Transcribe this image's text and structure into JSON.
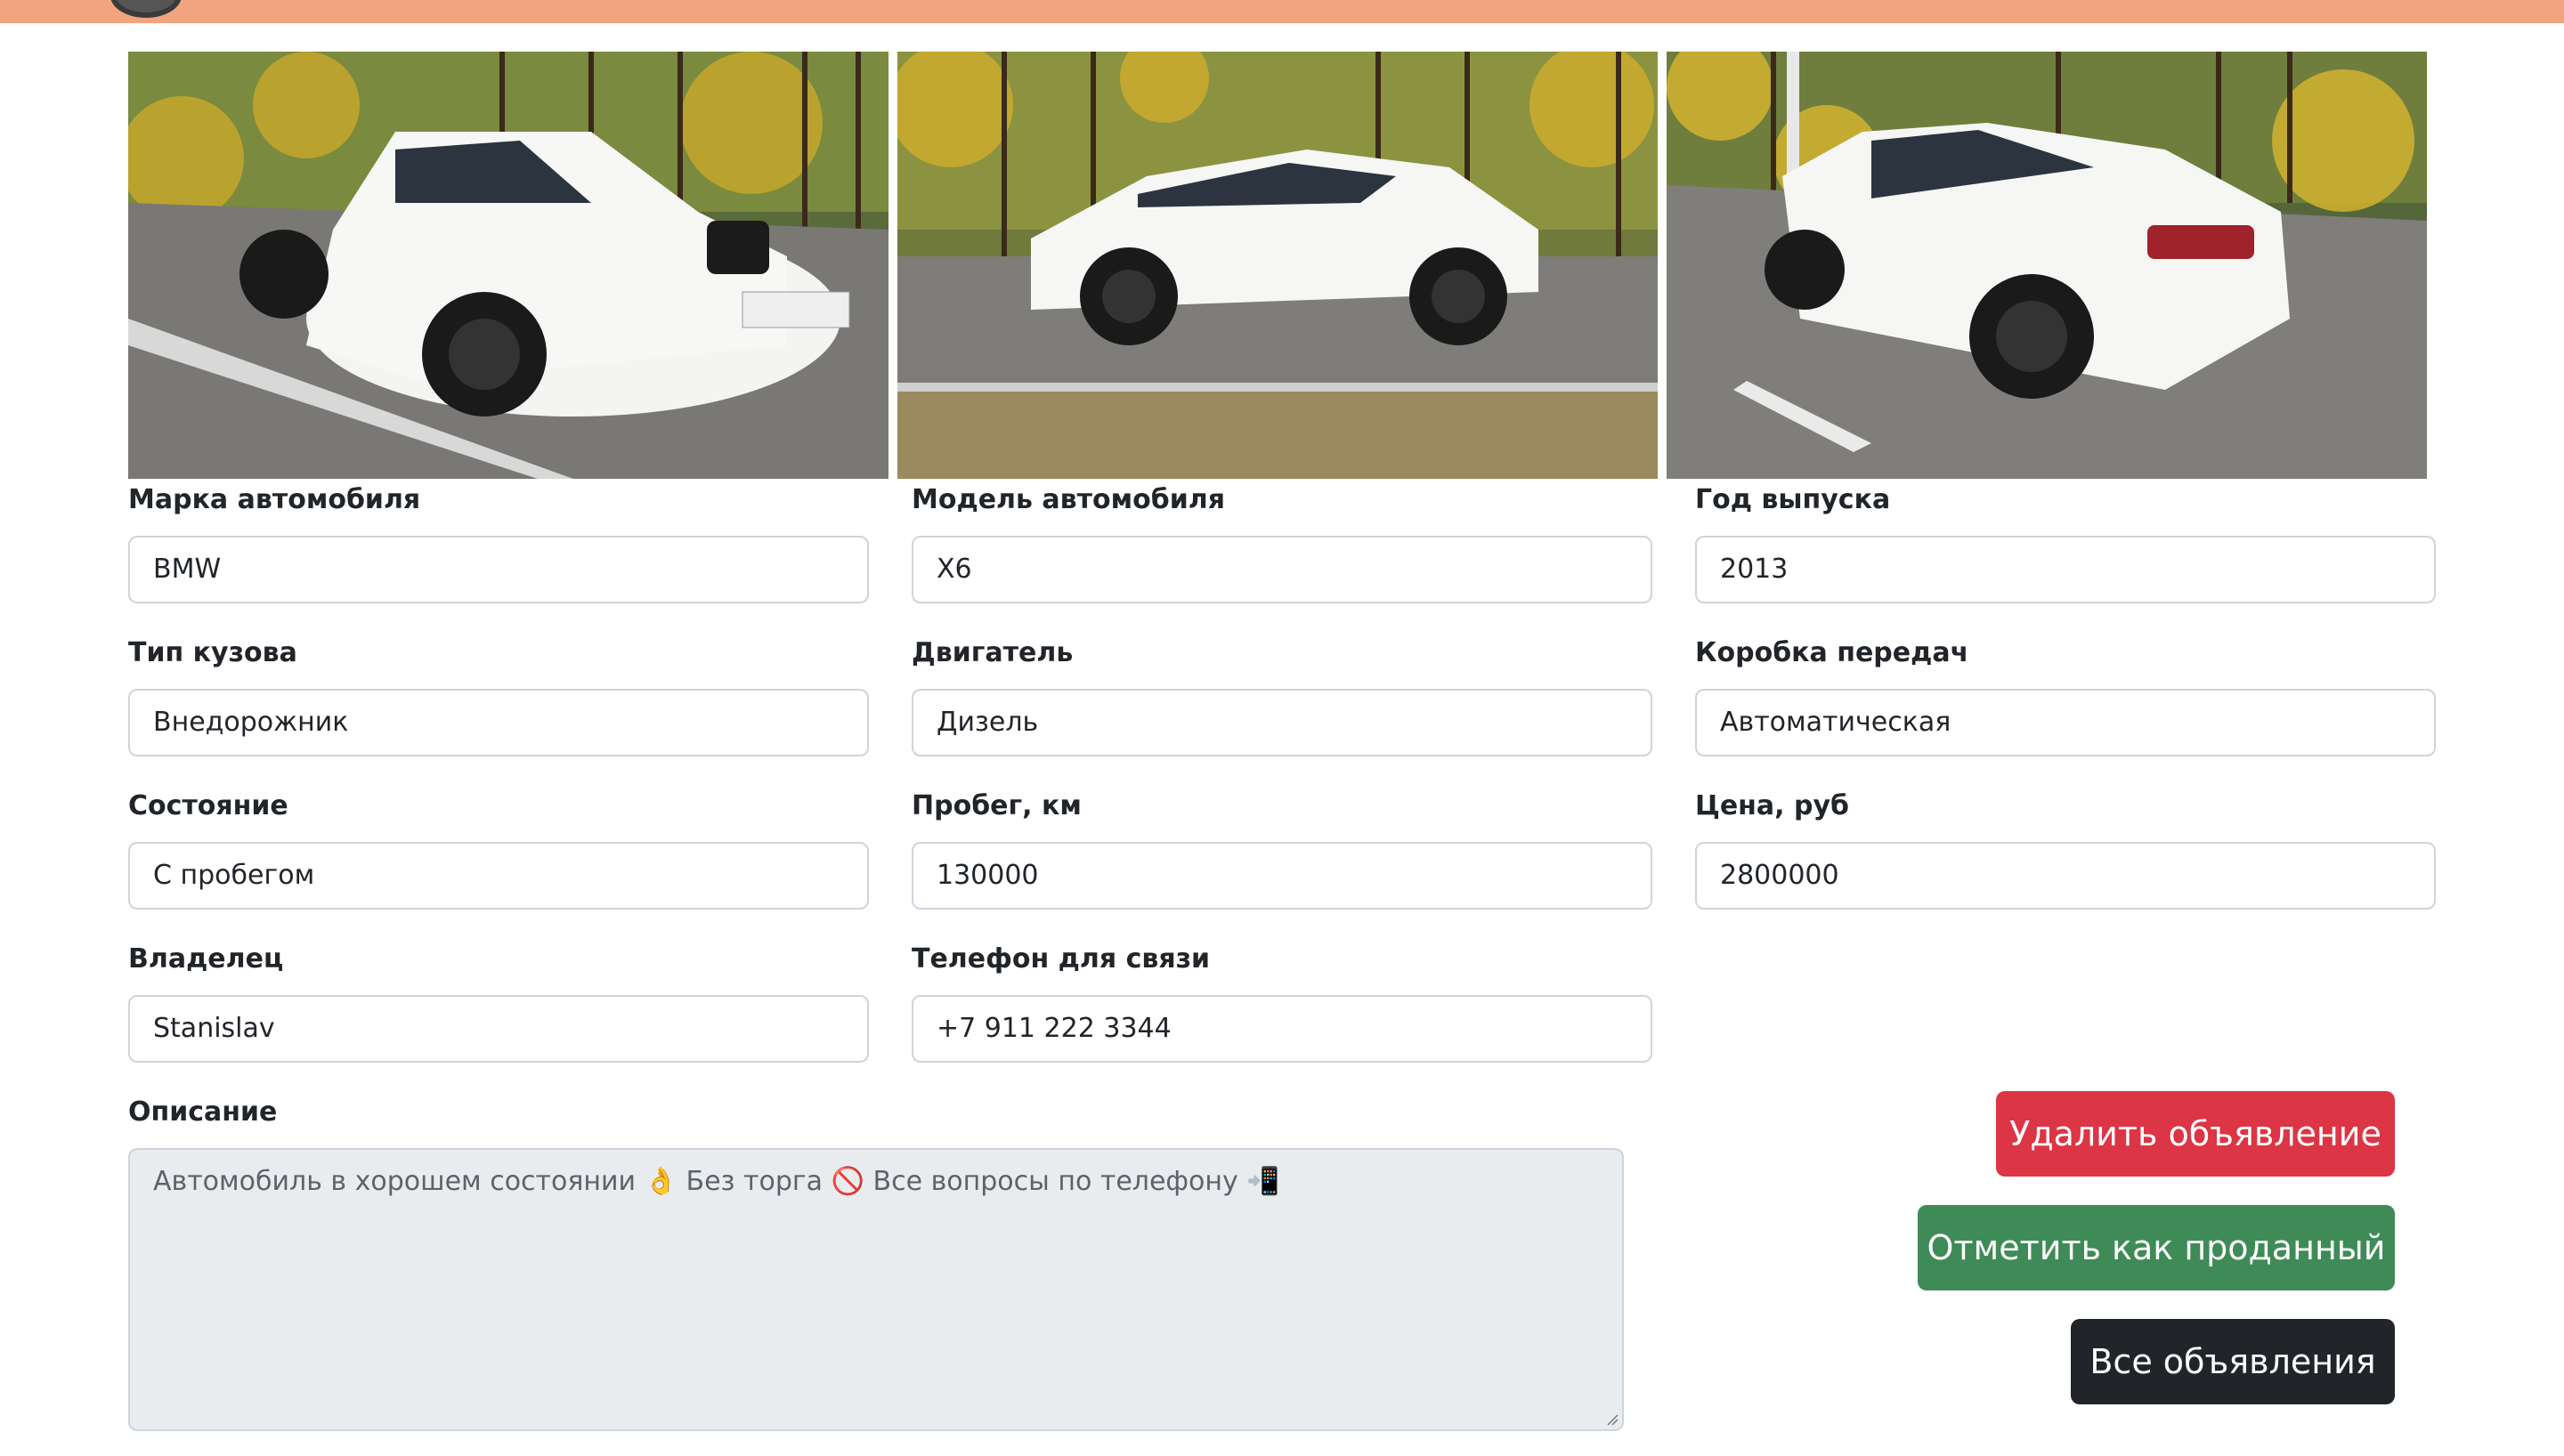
{
  "photos": [
    {
      "alt": "white-suv-front-three-quarter"
    },
    {
      "alt": "white-suv-side"
    },
    {
      "alt": "white-suv-rear-three-quarter"
    }
  ],
  "form": {
    "brand": {
      "label": "Марка автомобиля",
      "value": "BMW"
    },
    "model": {
      "label": "Модель автомобиля",
      "value": "X6"
    },
    "year": {
      "label": "Год выпуска",
      "value": "2013"
    },
    "body": {
      "label": "Тип кузова",
      "value": "Внедорожник"
    },
    "engine": {
      "label": "Двигатель",
      "value": "Дизель"
    },
    "gearbox": {
      "label": "Коробка передач",
      "value": "Автоматическая"
    },
    "condition": {
      "label": "Состояние",
      "value": "С пробегом"
    },
    "mileage": {
      "label": "Пробег, км",
      "value": "130000"
    },
    "price": {
      "label": "Цена, руб",
      "value": "2800000"
    },
    "owner": {
      "label": "Владелец",
      "value": "Stanislav"
    },
    "phone": {
      "label": "Телефон для связи",
      "value": "+7 911 222 3344"
    },
    "description": {
      "label": "Описание",
      "part1": "Автомобиль в хорошем состоянии",
      "emoji1": "👌",
      "part2": "Без торга",
      "emoji2": "🚫",
      "part3": "Все вопросы по телефону",
      "emoji3": "📲"
    }
  },
  "buttons": {
    "delete": "Удалить объявление",
    "mark_sold": "Отметить как проданный",
    "all_ads": "Все объявления"
  },
  "colors": {
    "topbar": "#f2a37f",
    "delete": "#dc3545",
    "mark_sold": "#3f8b57",
    "all_ads": "#212529"
  }
}
